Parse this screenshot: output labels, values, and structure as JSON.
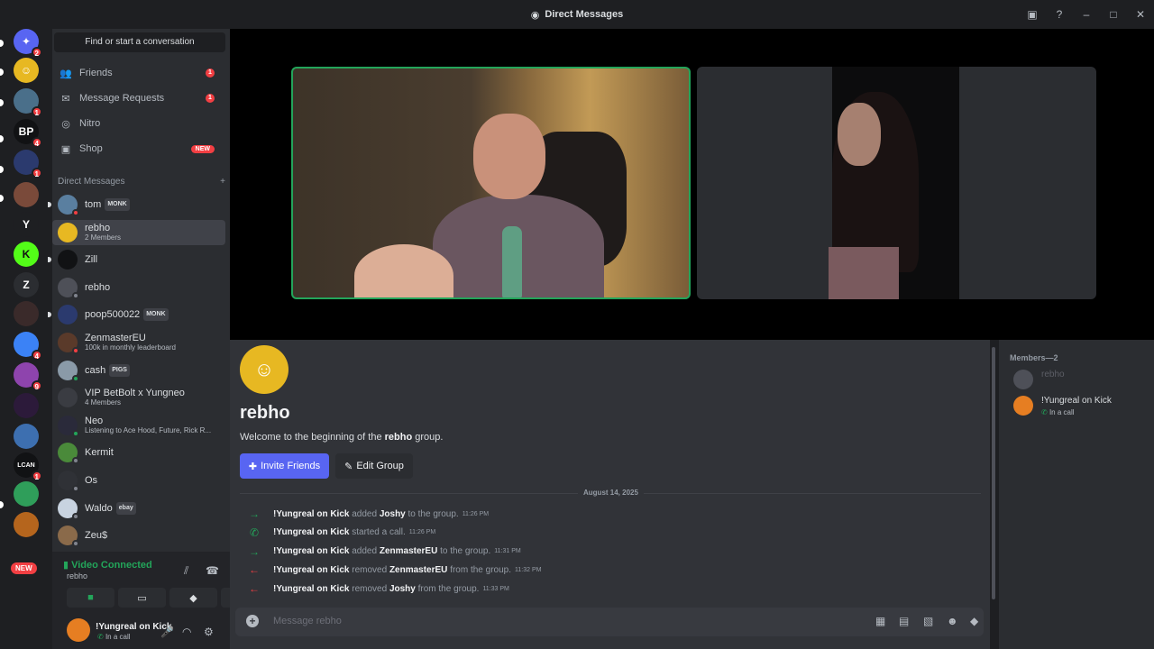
{
  "window": {
    "title": "Direct Messages"
  },
  "guilds": [
    {
      "label": "",
      "badge": "2",
      "color": "#5865f2",
      "glyph": "✦",
      "icon": "discord-icon"
    },
    {
      "label": "",
      "badge": "",
      "color": "#e7b822",
      "glyph": "☺",
      "icon": "group-icon"
    },
    {
      "label": "",
      "badge": "1",
      "color": "#4a6f8a",
      "glyph": "",
      "icon": "avatar-icon"
    },
    {
      "label": "BP",
      "badge": "4",
      "color": "#111214",
      "glyph": "BP",
      "icon": "server-icon"
    },
    {
      "label": "",
      "badge": "1",
      "color": "#2b3a6e",
      "glyph": "",
      "icon": "server-icon"
    },
    {
      "label": "",
      "badge": "",
      "color": "#7a4a3a",
      "glyph": "",
      "icon": "server-icon"
    },
    {
      "label": "Y",
      "badge": "",
      "color": "#1e1f22",
      "glyph": "Y",
      "icon": "server-icon"
    },
    {
      "label": "K",
      "badge": "",
      "color": "#53fc18",
      "glyph": "K",
      "icon": "kick-icon"
    },
    {
      "label": "Z",
      "badge": "",
      "color": "#2b2d31",
      "glyph": "Z",
      "icon": "server-icon"
    },
    {
      "label": "",
      "badge": "",
      "color": "#3a2a2a",
      "glyph": "",
      "icon": "server-icon"
    },
    {
      "label": "",
      "badge": "4",
      "color": "#3b82f6",
      "glyph": "",
      "icon": "server-icon"
    },
    {
      "label": "",
      "badge": "9",
      "color": "#8e44ad",
      "glyph": "",
      "icon": "server-icon"
    },
    {
      "label": "",
      "badge": "",
      "color": "#2c1a3a",
      "glyph": "",
      "icon": "server-icon"
    },
    {
      "label": "",
      "badge": "",
      "color": "#3d6fb0",
      "glyph": "",
      "icon": "server-icon"
    },
    {
      "label": "LCAN",
      "badge": "1",
      "color": "#111214",
      "glyph": "LCAN",
      "icon": "server-icon"
    },
    {
      "label": "",
      "badge": "",
      "color": "#2f9e5a",
      "glyph": "",
      "icon": "server-icon"
    },
    {
      "label": "",
      "badge": "",
      "color": "#b5651d",
      "glyph": "",
      "icon": "server-icon"
    }
  ],
  "guild_new_badge": "NEW",
  "sidebar": {
    "search_label": "Find or start a conversation",
    "nav": [
      {
        "label": "Friends",
        "icon": "friends-icon",
        "glyph": "👥",
        "count": "1",
        "pill": ""
      },
      {
        "label": "Message Requests",
        "icon": "mail-icon",
        "glyph": "✉",
        "count": "1",
        "pill": ""
      },
      {
        "label": "Nitro",
        "icon": "nitro-icon",
        "glyph": "◎",
        "count": "",
        "pill": ""
      },
      {
        "label": "Shop",
        "icon": "shop-icon",
        "glyph": "▣",
        "count": "",
        "pill": "NEW"
      }
    ],
    "dm_header": "Direct Messages",
    "dm_add": "+",
    "dms": [
      {
        "name": "tom",
        "sub": "",
        "tag": "MONK",
        "color": "#5a7fa0",
        "status": "#f23f43",
        "selected": false,
        "dot": true
      },
      {
        "name": "rebho",
        "sub": "2 Members",
        "tag": "",
        "color": "#e7b822",
        "status": "",
        "selected": true,
        "dot": false
      },
      {
        "name": "Zill",
        "sub": "",
        "tag": "",
        "color": "#111214",
        "status": "",
        "selected": false,
        "dot": true
      },
      {
        "name": "rebho",
        "sub": "",
        "tag": "",
        "color": "#4e5058",
        "status": "#80848e",
        "selected": false,
        "dot": false
      },
      {
        "name": "poop500022",
        "sub": "",
        "tag": "MONK",
        "color": "#2b3a6e",
        "status": "",
        "selected": false,
        "dot": true
      },
      {
        "name": "ZenmasterEU",
        "sub": "100k in monthly leaderboard",
        "tag": "",
        "color": "#5a3a2a",
        "status": "#f23f43",
        "selected": false,
        "dot": false
      },
      {
        "name": "cash",
        "sub": "",
        "tag": "PIGS",
        "color": "#8a9aa8",
        "status": "#23a55a",
        "selected": false,
        "dot": false
      },
      {
        "name": "VIP BetBolt x Yungneo",
        "sub": "4 Members",
        "tag": "",
        "color": "#3a3c42",
        "status": "",
        "selected": false,
        "dot": false
      },
      {
        "name": "Neo",
        "sub": "Listening to Ace Hood, Future, Rick R...",
        "tag": "",
        "color": "#2a2a3a",
        "status": "#23a55a",
        "selected": false,
        "dot": false
      },
      {
        "name": "Kermit",
        "sub": "",
        "tag": "",
        "color": "#4a8a3a",
        "status": "#80848e",
        "selected": false,
        "dot": false
      },
      {
        "name": "Os",
        "sub": "",
        "tag": "",
        "color": "#2f3136",
        "status": "#80848e",
        "selected": false,
        "dot": false
      },
      {
        "name": "Waldo",
        "sub": "",
        "tag": "ebay",
        "color": "#c8d3e0",
        "status": "#80848e",
        "selected": false,
        "dot": false
      },
      {
        "name": "Zeu$",
        "sub": "",
        "tag": "",
        "color": "#8a6a4a",
        "status": "#80848e",
        "selected": false,
        "dot": false
      }
    ]
  },
  "voice": {
    "status": "Video Connected",
    "channel": "rebho",
    "buttons": [
      {
        "icon": "camera-icon",
        "glyph": "■"
      },
      {
        "icon": "screen-share-icon",
        "glyph": "▭"
      },
      {
        "icon": "activity-icon",
        "glyph": "◆"
      },
      {
        "icon": "soundboard-icon",
        "glyph": "♫"
      }
    ]
  },
  "user": {
    "name": "!Yungreal on Kick",
    "status": "In a call"
  },
  "chat": {
    "group_name": "rebho",
    "welcome_prefix": "Welcome to the beginning of the ",
    "welcome_name": "rebho",
    "welcome_suffix": " group.",
    "invite_label": "Invite Friends",
    "edit_label": "Edit Group",
    "date_divider": "August 14, 2025",
    "messages": [
      {
        "arrow": "→",
        "arrow_color": "#23a55a",
        "actor": "!Yungreal on Kick",
        "verb": "added",
        "target": "Joshy",
        "rest": "to the group.",
        "time": "11:26 PM"
      },
      {
        "arrow": "✆",
        "arrow_color": "#23a55a",
        "actor": "!Yungreal on Kick",
        "verb": "started a call.",
        "target": "",
        "rest": "",
        "time": "11:26 PM"
      },
      {
        "arrow": "→",
        "arrow_color": "#23a55a",
        "actor": "!Yungreal on Kick",
        "verb": "added",
        "target": "ZenmasterEU",
        "rest": "to the group.",
        "time": "11:31 PM"
      },
      {
        "arrow": "←",
        "arrow_color": "#f23f43",
        "actor": "!Yungreal on Kick",
        "verb": "removed",
        "target": "ZenmasterEU",
        "rest": "from the group.",
        "time": "11:32 PM"
      },
      {
        "arrow": "←",
        "arrow_color": "#f23f43",
        "actor": "!Yungreal on Kick",
        "verb": "removed",
        "target": "Joshy",
        "rest": "from the group.",
        "time": "11:33 PM"
      }
    ],
    "composer_placeholder": "Message rebho"
  },
  "members": {
    "header": "Members—2",
    "list": [
      {
        "name": "rebho",
        "status": "",
        "color": "#4e5058",
        "name_color": "#5c5e66"
      },
      {
        "name": "!Yungreal on Kick",
        "status": "In a call",
        "color": "#e67e22",
        "name_color": "#dbdee1"
      }
    ]
  }
}
